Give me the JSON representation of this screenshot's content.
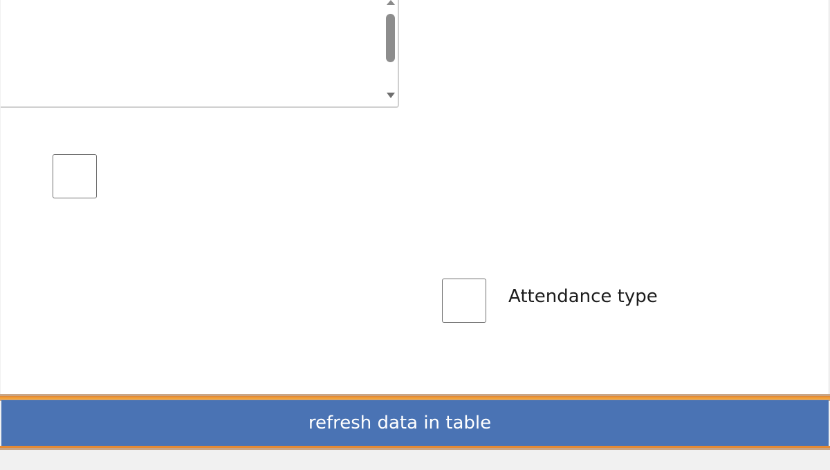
{
  "form": {
    "listbox": {
      "scroll_up_icon": "triangle-up",
      "scroll_down_icon": "triangle-down"
    },
    "checkbox_1": {
      "checked": false,
      "label": ""
    },
    "checkbox_2": {
      "checked": false,
      "label": "Attendance type"
    }
  },
  "footer": {
    "refresh_label": "refresh data in table"
  },
  "colors": {
    "button_bg": "#4a73b4",
    "button_text": "#ffffff",
    "accent_stripe": "#e48a35",
    "border": "#cfcfcf"
  }
}
